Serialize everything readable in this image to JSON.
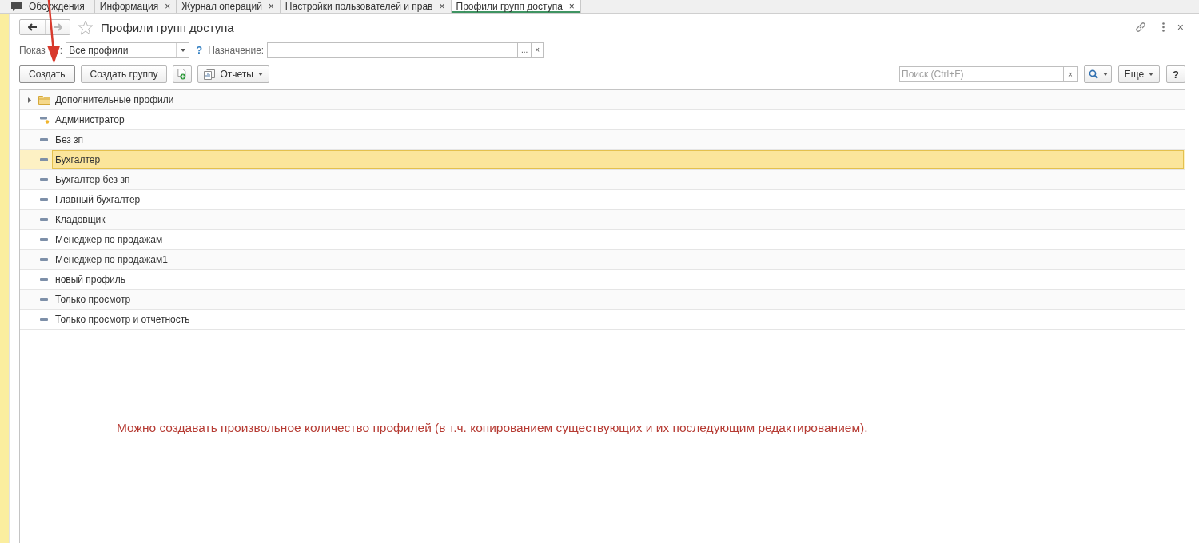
{
  "tabs": [
    {
      "kind": "pinned",
      "label": "Обсуждения",
      "selected": false
    },
    {
      "kind": "page",
      "label": "Информация",
      "close": "×",
      "selected": false
    },
    {
      "kind": "page",
      "label": "Журнал операций",
      "close": "×",
      "selected": false
    },
    {
      "kind": "page",
      "label": "Настройки пользователей и прав",
      "close": "×",
      "selected": false
    },
    {
      "kind": "page",
      "label": "Профили групп доступа",
      "close": "×",
      "selected": true
    }
  ],
  "form": {
    "title": "Профили групп доступа",
    "back": {
      "disabled": false
    },
    "forward": {
      "disabled": true
    },
    "favorite": false,
    "close": "×"
  },
  "filter": {
    "show": {
      "label_start": "Показ",
      "label_end": ":",
      "value": "Все профили"
    },
    "help": "?",
    "purpose": {
      "label": "Назначение:",
      "select_button": "...",
      "clear": "×"
    }
  },
  "toolbar": {
    "buttons": [
      {
        "kind": "default",
        "label": "Создать"
      },
      {
        "kind": "plain",
        "label": "Создать группу"
      },
      {
        "kind": "icon"
      },
      {
        "kind": "menu",
        "label": "Отчеты"
      }
    ],
    "search": {
      "placeholder": "Поиск (Ctrl+F)",
      "clear": "×"
    },
    "more": "Еще",
    "help": "?"
  },
  "list": {
    "items": [
      {
        "kind": "group",
        "label": "Дополнительные профили",
        "expanded": false,
        "selected": false
      },
      {
        "kind": "admin",
        "label": "Администратор",
        "selected": false
      },
      {
        "kind": "profile",
        "label": "Без зп",
        "selected": false
      },
      {
        "kind": "profile",
        "label": "Бухгалтер",
        "selected": true
      },
      {
        "kind": "profile",
        "label": "Бухгалтер без зп",
        "selected": false
      },
      {
        "kind": "profile",
        "label": "Главный бухгалтер",
        "selected": false
      },
      {
        "kind": "profile",
        "label": "Кладовщик",
        "selected": false
      },
      {
        "kind": "profile",
        "label": "Менеджер по продажам",
        "selected": false
      },
      {
        "kind": "profile",
        "label": "Менеджер по продажам1",
        "selected": false
      },
      {
        "kind": "profile",
        "label": "новый профиль",
        "selected": false
      },
      {
        "kind": "profile",
        "label": "Только просмотр",
        "selected": false
      },
      {
        "kind": "profile",
        "label": "Только просмотр и отчетность",
        "selected": false
      }
    ]
  },
  "annotation": {
    "text": "Можно создавать произвольное количество профилей (в т.ч. копированием существующих и их последующим редактированием)."
  }
}
